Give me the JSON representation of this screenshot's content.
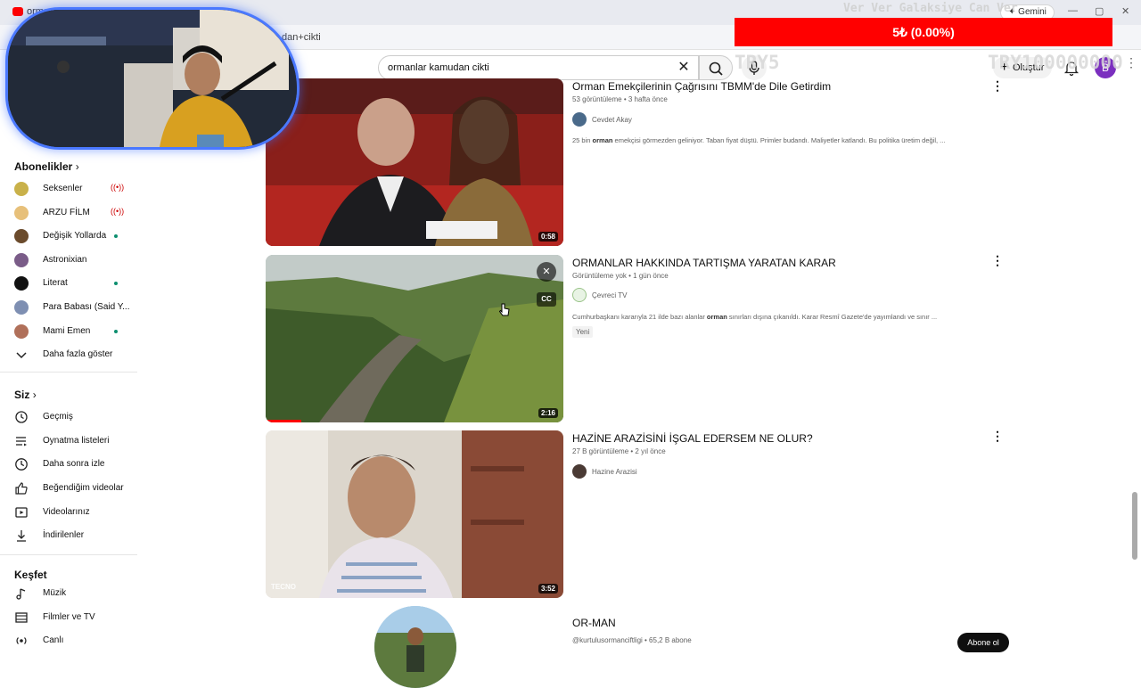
{
  "browser": {
    "tab_title": "orman",
    "url": "dan+cikti",
    "gemini_label": "Gemini",
    "window_controls": [
      "—",
      "▢",
      "✕"
    ]
  },
  "overlays": {
    "donation_bar": "5₺ (0.00%)",
    "galaxy_text": "Ver Ver Galaksiye Can Ver",
    "try5_text": "TRY5",
    "try_big_text": "TRY100000000"
  },
  "header": {
    "search_value": "ormanlar kamudan cikti",
    "create_label": "Oluştur",
    "avatar_letter": "B"
  },
  "sidebar": {
    "subscriptions_title": "Abonelikler",
    "subscriptions": [
      {
        "label": "Seksenler",
        "status": "live",
        "color": "#c9b14a"
      },
      {
        "label": "ARZU FİLM",
        "status": "live",
        "color": "#e7c07a"
      },
      {
        "label": "Değişik Yollarda",
        "status": "new",
        "color": "#6b4b2c"
      },
      {
        "label": "Astronixian",
        "status": "none",
        "color": "#7a5c88"
      },
      {
        "label": "Literat",
        "status": "new",
        "color": "#111111"
      },
      {
        "label": "Para Babası (Said Y...",
        "status": "none",
        "color": "#7e8fb2"
      },
      {
        "label": "Mami Emen",
        "status": "new",
        "color": "#b0705a"
      }
    ],
    "show_more_label": "Daha fazla göster",
    "you_title": "Siz",
    "you_items": [
      {
        "label": "Geçmiş",
        "icon": "history-icon"
      },
      {
        "label": "Oynatma listeleri",
        "icon": "playlist-icon"
      },
      {
        "label": "Daha sonra izle",
        "icon": "clock-icon"
      },
      {
        "label": "Beğendiğim videolar",
        "icon": "thumbs-up-icon"
      },
      {
        "label": "Videolarınız",
        "icon": "video-icon"
      },
      {
        "label": "İndirilenler",
        "icon": "download-icon"
      }
    ],
    "explore_title": "Keşfet",
    "explore_items": [
      {
        "label": "Müzik",
        "icon": "music-icon"
      },
      {
        "label": "Filmler ve TV",
        "icon": "film-icon"
      },
      {
        "label": "Canlı",
        "icon": "live-icon"
      }
    ]
  },
  "results": [
    {
      "title": "Orman Emekçilerinin Çağrısını TBMM'de Dile Getirdim",
      "meta": "53 görüntüleme • 3 hafta önce",
      "channel": "Cevdet Akay",
      "description_before": "25 bin ",
      "description_bold": "orman",
      "description_after": " emekçisi görmezden geliniyor. Taban fiyat düştü. Primler budandı. Maliyetler katlandı. Bu politika üretim değil, ...",
      "duration": "0:58",
      "badge": ""
    },
    {
      "title": "ORMANLAR HAKKINDA TARTIŞMA YARATAN KARAR",
      "meta": "Görüntüleme yok • 1 gün önce",
      "channel": "Çevreci TV",
      "description_before": "Cumhurbaşkanı kararıyla 21 ilde bazı alanlar ",
      "description_bold": "orman",
      "description_after": " sınırları dışına çıkanıldı. Karar Resmî Gazete'de yayımlandı ve sınır ...",
      "duration": "2:16",
      "badge": "Yeni"
    },
    {
      "title": "HAZİNE ARAZİSİNİ İŞGAL EDERSEM NE OLUR?",
      "meta": "27 B görüntüleme • 2 yıl önce",
      "channel": "Hazine Arazisi",
      "description_before": "",
      "description_bold": "",
      "description_after": "",
      "duration": "3:52",
      "badge": "",
      "watermark": "TECNO"
    }
  ],
  "channel_result": {
    "title": "OR-MAN",
    "meta": "@kurtulusormanciftligi • 65,2 B abone",
    "subscribe_label": "Abone ol"
  },
  "colors": {
    "donation_red": "#ff0000",
    "facecam_border": "#4a78ff",
    "avatar_purple": "#7b2fbf"
  }
}
